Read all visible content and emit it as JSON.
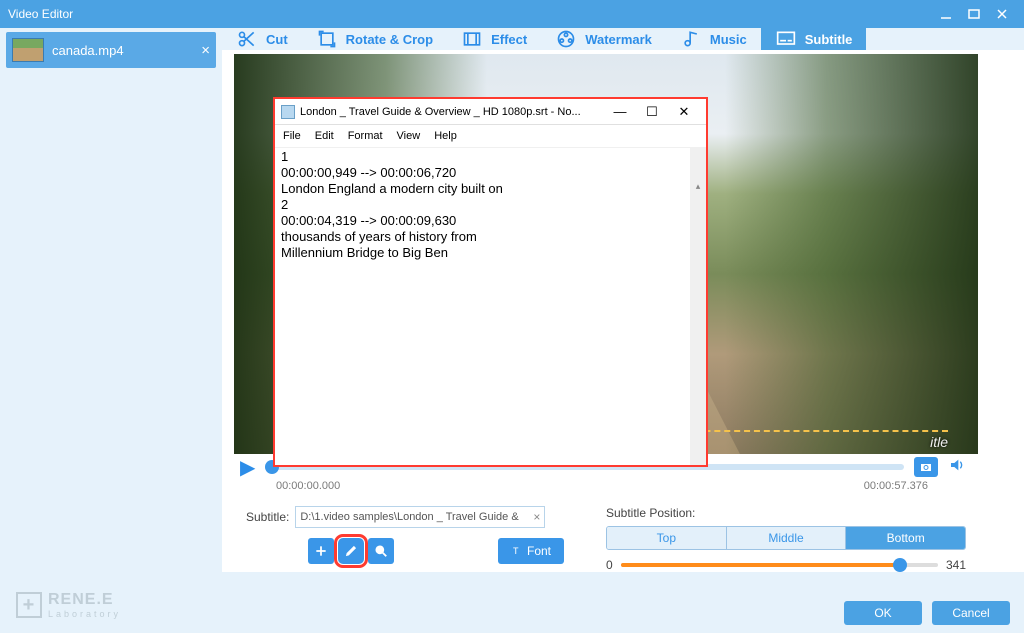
{
  "title": "Video Editor",
  "file": {
    "name": "canada.mp4"
  },
  "tabs": {
    "cut": "Cut",
    "rotate": "Rotate & Crop",
    "effect": "Effect",
    "watermark": "Watermark",
    "music": "Music",
    "subtitle": "Subtitle"
  },
  "preview": {
    "subtitle_fragment": "itle",
    "time_start": "00:00:00.000",
    "time_end": "00:00:57.376"
  },
  "subtitle": {
    "label": "Subtitle:",
    "path": "D:\\1.video samples\\London _ Travel Guide &",
    "font_btn": "Font"
  },
  "position": {
    "label": "Subtitle Position:",
    "top": "Top",
    "middle": "Middle",
    "bottom": "Bottom",
    "min": "0",
    "max": "341"
  },
  "footer": {
    "ok": "OK",
    "cancel": "Cancel"
  },
  "logo": {
    "brand": "RENE.E",
    "sub": "Laboratory"
  },
  "notepad": {
    "title": "London _ Travel Guide & Overview _ HD 1080p.srt - No...",
    "menu": {
      "file": "File",
      "edit": "Edit",
      "format": "Format",
      "view": "View",
      "help": "Help"
    },
    "content": "1\n00:00:00,949 --> 00:00:06,720\nLondon England a modern city built on\n2\n00:00:04,319 --> 00:00:09,630\nthousands of years of history from\nMillennium Bridge to Big Ben"
  }
}
